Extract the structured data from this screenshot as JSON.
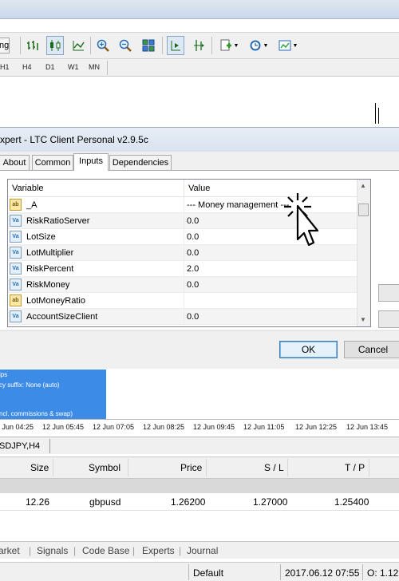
{
  "toolbar": {
    "first_button_label": "ng",
    "buttons": [
      "bar-chart-icon",
      "candlestick-icon",
      "line-chart-icon",
      "zoom-in-icon",
      "zoom-out-icon",
      "tile-windows-icon",
      "chart-shift-icon",
      "autoscroll-icon",
      "indicators-icon",
      "periodicity-icon",
      "templates-icon"
    ]
  },
  "timeframes": [
    "H1",
    "H4",
    "D1",
    "W1",
    "MN"
  ],
  "dialog": {
    "title": "xpert - LTC Client Personal v2.9.5c",
    "tabs": [
      "About",
      "Common",
      "Inputs",
      "Dependencies"
    ],
    "active_tab": "Inputs",
    "grid": {
      "columns": [
        "Variable",
        "Value"
      ],
      "rows": [
        {
          "icon": "ab",
          "name": "_A",
          "value": "--- Money management ---"
        },
        {
          "icon": "val",
          "name": "RiskRatioServer",
          "value": "0.0"
        },
        {
          "icon": "val",
          "name": "LotSize",
          "value": "0.0"
        },
        {
          "icon": "val",
          "name": "LotMultiplier",
          "value": "0.0"
        },
        {
          "icon": "val",
          "name": "RiskPercent",
          "value": "2.0"
        },
        {
          "icon": "val",
          "name": "RiskMoney",
          "value": "0.0"
        },
        {
          "icon": "ab",
          "name": "LotMoneyRatio",
          "value": ""
        },
        {
          "icon": "val",
          "name": "AccountSizeClient",
          "value": "0.0"
        }
      ]
    },
    "ok_label": "OK",
    "cancel_label": "Cancel"
  },
  "info_panel": {
    "line1": "ips",
    "line2": "cy suffix: None (auto)",
    "line3": "ncl. commissions & swap)"
  },
  "time_axis": [
    "2 Jun 04:25",
    "12 Jun 05:45",
    "12 Jun 07:05",
    "12 Jun 08:25",
    "12 Jun 09:45",
    "12 Jun 11:05",
    "12 Jun 12:25",
    "12 Jun 13:45"
  ],
  "chart_tab": "SDJPY,H4",
  "trade": {
    "columns": [
      "Size",
      "Symbol",
      "Price",
      "S / L",
      "T / P"
    ],
    "row": {
      "size": "12.26",
      "symbol": "gbpusd",
      "price": "1.26200",
      "sl": "1.27000",
      "tp": "1.25400"
    }
  },
  "terminal_tabs": [
    "arket",
    "Signals",
    "Code Base",
    "Experts",
    "Journal"
  ],
  "status": {
    "profile": "Default",
    "datetime": "2017.06.12 07:55",
    "open": "O: 1.12"
  }
}
